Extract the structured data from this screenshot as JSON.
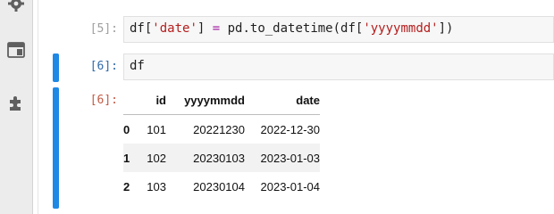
{
  "sidebar": {
    "icons": [
      {
        "name": "gear-icon"
      },
      {
        "name": "tab-panel-icon"
      },
      {
        "name": "extension-icon"
      }
    ]
  },
  "cells": [
    {
      "prompt": "[5]:",
      "code_tokens": [
        {
          "text": "df[",
          "kind": "plain"
        },
        {
          "text": "'date'",
          "kind": "str"
        },
        {
          "text": "] ",
          "kind": "plain"
        },
        {
          "text": "=",
          "kind": "op"
        },
        {
          "text": " pd.to_datetime(df[",
          "kind": "plain"
        },
        {
          "text": "'yyyymmdd'",
          "kind": "str"
        },
        {
          "text": "])",
          "kind": "plain"
        }
      ]
    },
    {
      "prompt": "[6]:",
      "code_tokens": [
        {
          "text": "df",
          "kind": "plain"
        }
      ]
    }
  ],
  "output": {
    "prompt": "[6]:",
    "table": {
      "columns": [
        "",
        "id",
        "yyyymmdd",
        "date"
      ],
      "rows": [
        {
          "index": "0",
          "id": "101",
          "yyyymmdd": "20221230",
          "date": "2022-12-30"
        },
        {
          "index": "1",
          "id": "102",
          "yyyymmdd": "20230103",
          "date": "2023-01-03"
        },
        {
          "index": "2",
          "id": "103",
          "yyyymmdd": "20230104",
          "date": "2023-01-04"
        }
      ]
    }
  },
  "colors": {
    "active_cell_bar": "#1e88e5",
    "prompt_in": "#2f6aa8",
    "prompt_out": "#c25a45",
    "string_literal": "#b51d1d",
    "operator": "#a21ea2"
  }
}
